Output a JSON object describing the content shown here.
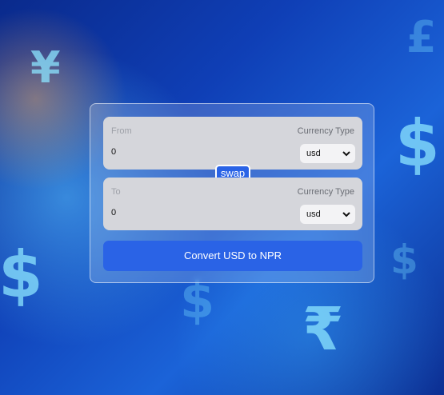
{
  "background": {
    "glyphs": [
      "¥",
      "£",
      "$",
      "$",
      "$",
      "₹",
      "$"
    ]
  },
  "converter": {
    "swap_label": "swap",
    "convert_label": "Convert USD to NPR",
    "from": {
      "label": "From",
      "currency_type_label": "Currency Type",
      "amount": "0",
      "currency": "usd"
    },
    "to": {
      "label": "To",
      "currency_type_label": "Currency Type",
      "amount": "0",
      "currency": "usd"
    }
  },
  "colors": {
    "accent": "#2a63e6",
    "panel": "#d5d6db"
  },
  "icons": {
    "dropdown": "chevron-down-icon"
  }
}
